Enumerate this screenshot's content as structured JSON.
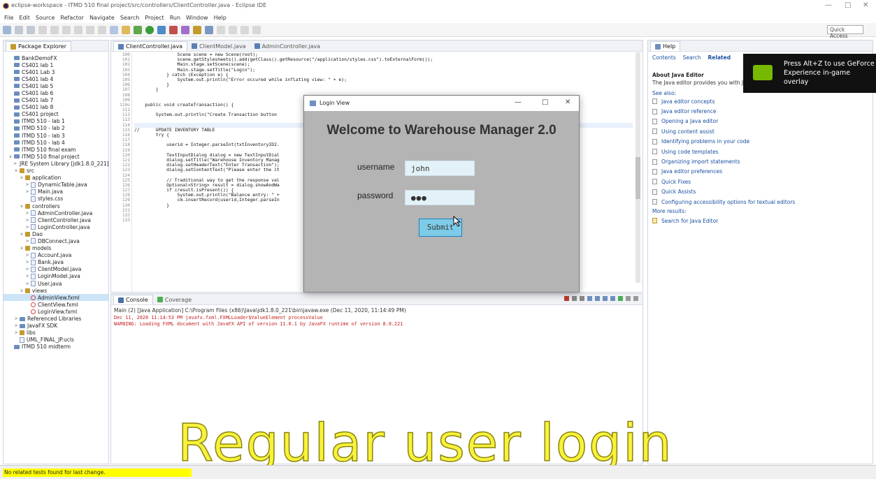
{
  "window": {
    "title": "eclipse-workspace - ITMD 510 final project/src/controllers/ClientController.java - Eclipse IDE",
    "controls": [
      "—",
      "□",
      "✕"
    ]
  },
  "menu": [
    "File",
    "Edit",
    "Source",
    "Refactor",
    "Navigate",
    "Search",
    "Project",
    "Run",
    "Window",
    "Help"
  ],
  "toolbar": {
    "quick_access": "Quick Access"
  },
  "package_explorer": {
    "tab": "Package Explorer",
    "items": [
      {
        "text": "BankDemoFX",
        "kind": "project",
        "indent": 0
      },
      {
        "text": "CS401 lab 1",
        "kind": "project",
        "indent": 0
      },
      {
        "text": "CS401 Lab 3",
        "kind": "project",
        "indent": 0
      },
      {
        "text": "CS401 lab 4",
        "kind": "project",
        "indent": 0
      },
      {
        "text": "CS401 lab 5",
        "kind": "project",
        "indent": 0
      },
      {
        "text": "CS401 lab 6",
        "kind": "project",
        "indent": 0
      },
      {
        "text": "CS401 lab 7",
        "kind": "project",
        "indent": 0
      },
      {
        "text": "CS401 lab 8",
        "kind": "project",
        "indent": 0
      },
      {
        "text": "CS401 project",
        "kind": "project",
        "indent": 0
      },
      {
        "text": "ITMD 510 - lab 1",
        "kind": "project",
        "indent": 0
      },
      {
        "text": "ITMD 510 - lab 2",
        "kind": "project",
        "indent": 0
      },
      {
        "text": "ITMD 510 - lab 3",
        "kind": "project",
        "indent": 0
      },
      {
        "text": "ITMD 510 - lab 4",
        "kind": "project",
        "indent": 0
      },
      {
        "text": "ITMD 510 final exam",
        "kind": "project",
        "indent": 0
      },
      {
        "text": "ITMD 510 final project",
        "kind": "project",
        "indent": 0,
        "arrow": "∨"
      },
      {
        "text": "JRE System Library [jdk1.8.0_221]",
        "kind": "lib",
        "indent": 1,
        "arrow": ">"
      },
      {
        "text": "src",
        "kind": "src",
        "indent": 1,
        "arrow": "∨"
      },
      {
        "text": "application",
        "kind": "pkg",
        "indent": 2,
        "arrow": "∨"
      },
      {
        "text": "DynamicTable.java",
        "kind": "java",
        "indent": 3,
        "arrow": ">"
      },
      {
        "text": "Main.java",
        "kind": "java",
        "indent": 3,
        "arrow": ">"
      },
      {
        "text": "styles.css",
        "kind": "css",
        "indent": 3
      },
      {
        "text": "controllers",
        "kind": "pkg",
        "indent": 2,
        "arrow": "∨"
      },
      {
        "text": "AdminController.java",
        "kind": "java",
        "indent": 3,
        "arrow": ">"
      },
      {
        "text": "ClientController.java",
        "kind": "java",
        "indent": 3,
        "arrow": ">"
      },
      {
        "text": "LoginController.java",
        "kind": "java",
        "indent": 3,
        "arrow": ">"
      },
      {
        "text": "Dao",
        "kind": "pkg",
        "indent": 2,
        "arrow": "∨"
      },
      {
        "text": "DBConnect.java",
        "kind": "java",
        "indent": 3,
        "arrow": ">"
      },
      {
        "text": "models",
        "kind": "pkg",
        "indent": 2,
        "arrow": "∨"
      },
      {
        "text": "Account.java",
        "kind": "java",
        "indent": 3,
        "arrow": ">"
      },
      {
        "text": "Bank.java",
        "kind": "java",
        "indent": 3,
        "arrow": ">"
      },
      {
        "text": "ClientModel.java",
        "kind": "java",
        "indent": 3,
        "arrow": ">"
      },
      {
        "text": "LoginModel.java",
        "kind": "java",
        "indent": 3,
        "arrow": ">"
      },
      {
        "text": "User.java",
        "kind": "java",
        "indent": 3,
        "arrow": ">"
      },
      {
        "text": "views",
        "kind": "pkg",
        "indent": 2,
        "arrow": "∨"
      },
      {
        "text": "AdminView.fxml",
        "kind": "fxml",
        "indent": 3,
        "selected": true
      },
      {
        "text": "ClientView.fxml",
        "kind": "fxml",
        "indent": 3
      },
      {
        "text": "LoginView.fxml",
        "kind": "fxml",
        "indent": 3
      },
      {
        "text": "Referenced Libraries",
        "kind": "lib",
        "indent": 1,
        "arrow": ">"
      },
      {
        "text": "JavaFX SDK",
        "kind": "lib",
        "indent": 1,
        "arrow": ">"
      },
      {
        "text": "libs",
        "kind": "folder",
        "indent": 1,
        "arrow": ">"
      },
      {
        "text": "UML_FINAL_JP.ucls",
        "kind": "file",
        "indent": 1
      },
      {
        "text": "ITMD 510 midterm",
        "kind": "project",
        "indent": 0
      }
    ]
  },
  "editor": {
    "tabs": [
      "ClientController.java",
      "ClientModel.java",
      "AdminController.java"
    ],
    "line_numbers": [
      "100",
      "101",
      "102",
      "103",
      "104",
      "105",
      "106",
      "107",
      "108",
      "109",
      "110⊖",
      "111",
      "112",
      "113",
      "114",
      "115",
      "116",
      "117",
      "118",
      "119",
      "120",
      "121",
      "122",
      "123",
      "124",
      "125",
      "126",
      "127",
      "128",
      "129",
      "130",
      "131",
      "132",
      "133"
    ],
    "lines": [
      "                Scene scene = new Scene(root);",
      "                scene.getStylesheets().add(getClass().getResource(\"/application/styles.css\").toExternalForm());",
      "                Main.stage.setScene(scene);",
      "                Main.stage.setTitle(\"Login\");",
      "            } catch (Exception e) {",
      "                System.out.println(\"Error occured while inflating view: \" + e);",
      "            }",
      "        }",
      "",
      "",
      "    public void createTransaction() {",
      "",
      "        System.out.println(\"Create Transaction button",
      "",
      "",
      "//      UPDATE INVENTORY TABLE",
      "        try {",
      "",
      "            userid = Integer.parseInt(txtInventoryID2.",
      "",
      "            TextInputDialog dialog = new TextInputDial",
      "            dialog.setTitle(\"Warehouse Inventory Manag",
      "            dialog.setHeaderText(\"Enter Transaction\");",
      "            dialog.setContentText(\"Please enter the it",
      "",
      "            // Traditional way to get the response val",
      "            Optional<String> result = dialog.showAndWa",
      "            if (result.isPresent()) {",
      "                System.out.println(\"Balance entry: \" +",
      "                cm.insertRecord(userid,Integer.parseIn",
      "            }",
      "",
      "",
      ""
    ]
  },
  "console": {
    "tabs": [
      "Console",
      "Coverage"
    ],
    "path": "Main (2) [Java Application] C:\\Program Files (x86)\\Java\\jdk1.8.0_221\\bin\\javaw.exe (Dec 11, 2020, 11:14:49 PM)",
    "lines": [
      "Dec 11, 2020 11:14:53 PM javafx.fxml.FXMLLoader$ValueElement processValue",
      "WARNING: Loading FXML document with JavaFX API of version 11.0.1 by JavaFX runtime of version 8.0.221"
    ]
  },
  "help": {
    "tab": "Help",
    "nav": [
      "Contents",
      "Search",
      "Related"
    ],
    "heading": "About Java Editor",
    "desc": "The Java editor provides you with Jav",
    "see_also": "See also:",
    "links": [
      "Java editor concepts",
      "Java editor reference",
      "Opening a Java editor",
      "Using content assist",
      "Identifying problems in your code",
      "Using code templates",
      "Organizing import statements",
      "Java editor preferences",
      "Quick Fixes",
      "Quick Assists",
      "Configuring accessibility options for textual editors"
    ],
    "more_results": "More results:",
    "search_link": "Search for Java Editor"
  },
  "geforce": {
    "text": "Press Alt+Z to use GeForce Experience in-game overlay"
  },
  "login": {
    "window_title": "Login View",
    "controls": [
      "—",
      "□",
      "✕"
    ],
    "heading": "Welcome to Warehouse Manager 2.0",
    "username_label": "username",
    "username_value": "john",
    "password_label": "password",
    "password_value": "●●●",
    "submit_label": "Submit"
  },
  "caption": "Regular user login",
  "status": {
    "text": "No related tests found for last change."
  },
  "colors": {
    "caption": "#f8f23a",
    "submit": "#7ecbe7",
    "geforce": "#76b900",
    "status_highlight": "#ffff00"
  }
}
